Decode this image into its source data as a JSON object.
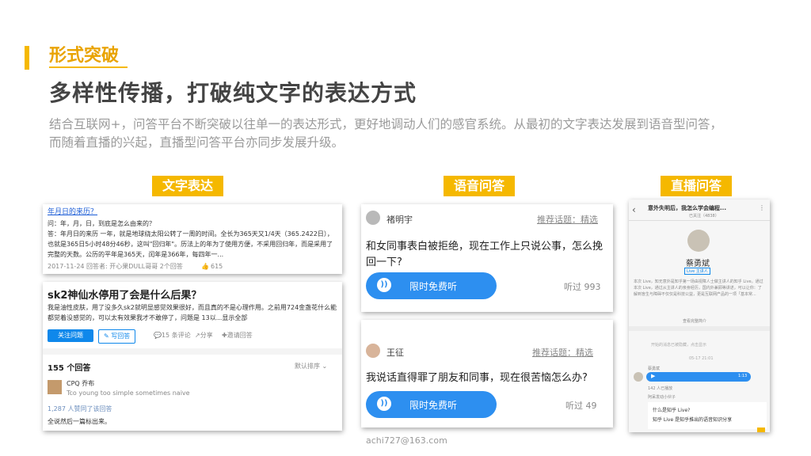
{
  "header": {
    "section_label": "形式突破",
    "title": "多样性传播，打破纯文字的表达方式",
    "description": "结合互联网+，问答平台不断突破以往单一的表达形式，更好地调动人们的感官系统。从最初的文字表达发展到语音型问答，而随着直播的兴起，直播型问答平台亦同步发展升级。"
  },
  "columns": {
    "text": "文字表达",
    "voice": "语音问答",
    "live": "直播问答"
  },
  "text_card_1": {
    "question": "年月日的来历？",
    "lines": [
      "问：年，月，日，到底是怎么由来的？",
      "答：年月日的来历 一年，就是地球绕太阳公转了一周的时间。全长为365天又1/4天（365.2422日），",
      "也就是365日5小时48分46秒，这叫\"回归年\"。历法上的年为了使用方便，不采用回归年，而是采用了",
      "完整的天数。公历的平年是365天，闰年是366年，每四年一..."
    ],
    "meta": "2017-11-24   回答者: 开心果DULL哥哥   2个回答",
    "likes": "615"
  },
  "text_card_2": {
    "question": "sk2神仙水停用了会是什么后果？",
    "body": "我是油性皮肤，用了没多久sk2就明显感觉效果很好，而且真的不是心理作用。之前用724金盏花什么能都觉着没感觉的，可以太有效果我才不敢停了，问题是 13以...显示全部",
    "follow": "关注问题",
    "write": "写回答",
    "comments": "15 条评论",
    "share": "分享",
    "invite": "邀请回答",
    "answers_count": "155 个回答",
    "sort": "默认排序",
    "user": "CPQ 乔布",
    "reply": "Tco young too simple sometimes naive",
    "approve": "1,287 人赞同了该回答",
    "last_line": "全说然后一篇标出来。"
  },
  "voice_card_1": {
    "name": "褚明宇",
    "topic": "推荐话题：精选",
    "question": "和女同事表白被拒绝，现在工作上只说公事，怎么挽回一下?",
    "btn": "限时免费听",
    "listened": "听过 993"
  },
  "voice_card_2": {
    "name": "王征",
    "topic": "推荐话题：精选",
    "question": "我说话直得罪了朋友和同事，现在很苦恼怎么办?",
    "btn": "限时免费听",
    "listened": "听过 49"
  },
  "live_card": {
    "title": "意外失明后，我怎么学会编程...",
    "subtitle": "已关注（4838）",
    "host": "蔡勇斌",
    "host_tag": "Live 主讲人",
    "intro": "本次 Live，知无意外是知乎第一场由视障人士做主讲人的知乎 Live。通过本次 Live，通过从主讲人的亲身经历，国内外兼顾等讲述，可以让你：了解到盲生与障碍不仅仅是科技公益，更是互联网产品的一项「基本常...",
    "more": "查看完整简介",
    "notice": "开始的消息已被隐藏，点击显示",
    "time": "05-17 21:01",
    "msg_label": "蔡勇斌",
    "audio_len": "1:13",
    "listened": "142 人已播放",
    "asker": "阿呆发动小伙子",
    "q_title": "什么是知乎 Live?",
    "q_body": "知乎 Live 是知乎推出的语音知识分享"
  },
  "footer": {
    "email": "achi727@163.com"
  },
  "colors": {
    "accent": "#f5b800",
    "voice_blue": "#2d8ff0",
    "zhihu_blue": "#0f88eb"
  }
}
